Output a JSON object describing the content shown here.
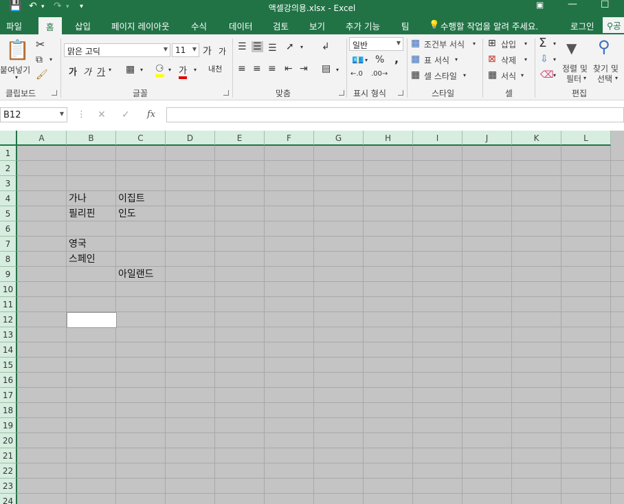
{
  "title_bar": {
    "title": "액셀강의용.xlsx - Excel",
    "save_icon": "save-icon",
    "undo_icon": "undo-icon",
    "redo_icon": "redo-icon",
    "customize_icon": "customize-qat-icon"
  },
  "tabs": [
    "파일",
    "홈",
    "삽입",
    "페이지 레이아웃",
    "수식",
    "데이터",
    "검토",
    "보기",
    "추가 기능",
    "팀"
  ],
  "active_tab": "홈",
  "tell_me": "수행할 작업을 알려 주세요.",
  "login": "로그인",
  "share": "공",
  "ribbon": {
    "clipboard": {
      "paste": "붙여넣기",
      "group": "클립보드"
    },
    "font": {
      "font_name": "맑은 고딕",
      "font_size": "11",
      "grow": "가",
      "shrink": "가",
      "bold": "가",
      "italic": "가",
      "underline": "가",
      "font_color_glyph": "가",
      "phonetic": "내천",
      "group": "글꼴"
    },
    "alignment": {
      "group": "맞춤"
    },
    "number": {
      "format": "일반",
      "percent": "%",
      "comma": ",",
      "group": "표시 형식"
    },
    "styles": {
      "conditional": "조건부 서식",
      "table": "표 서식",
      "cell_style": "셀 스타일",
      "group": "스타일"
    },
    "cells": {
      "insert": "삽입",
      "delete": "삭제",
      "format": "서식",
      "group": "셀"
    },
    "editing": {
      "sort": "정렬 및",
      "sort2": "필터",
      "find": "찾기 및",
      "find2": "선택",
      "group": "편집"
    }
  },
  "formula_bar": {
    "name_box": "B12",
    "fx": "fx",
    "cancel": "✕",
    "enter": "✓",
    "value": ""
  },
  "grid": {
    "columns": [
      "A",
      "B",
      "C",
      "D",
      "E",
      "F",
      "G",
      "H",
      "I",
      "J",
      "K",
      "L"
    ],
    "rows": [
      "1",
      "2",
      "3",
      "4",
      "5",
      "6",
      "7",
      "8",
      "9",
      "10",
      "11",
      "12",
      "13",
      "14",
      "15",
      "16",
      "17",
      "18",
      "19",
      "20",
      "21",
      "22",
      "23",
      "24"
    ],
    "cells": {
      "B4": "가나",
      "C4": "이집트",
      "B5": "필리핀",
      "C5": "인도",
      "B7": "영국",
      "B8": "스페인",
      "C9": "아일랜드"
    },
    "selected_cell": "B12"
  }
}
